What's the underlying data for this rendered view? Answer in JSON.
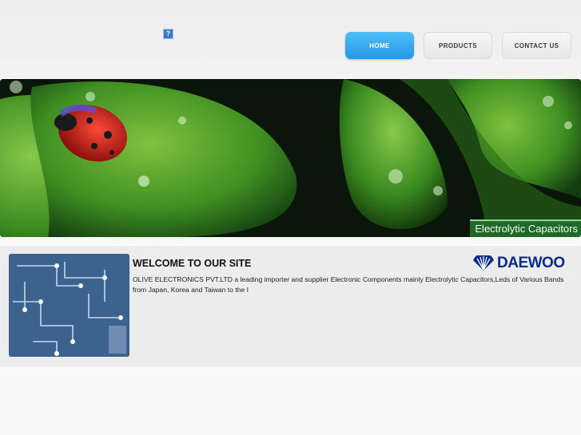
{
  "nav": {
    "help_icon": "help-icon",
    "home": "HOME",
    "products": "PRODUCTS",
    "contact": "CONTACT US",
    "active_color": "#2da3ec"
  },
  "banner": {
    "caption": "Electrolytic Capacitors"
  },
  "content": {
    "heading": "WELCOME TO OUR SITE",
    "body": "OLIVE ELECTRONICS PVT.LTD a leading importer and supplier Electronic Components mainly Electrolytic Capacitors,Leds of Various Bands from Japan, Korea and Taiwan to the I",
    "logo_text": "DAEWOO",
    "logo_color": "#0b2a8c"
  }
}
